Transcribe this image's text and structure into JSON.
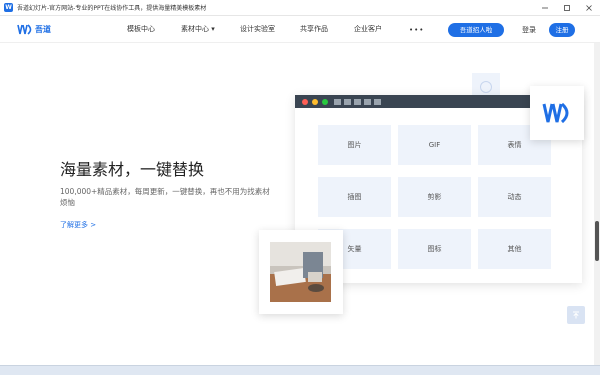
{
  "window": {
    "title": "吾道幻灯片-官方网站-专业的PPT在线协作工具，提供海量精美模板素材",
    "app_icon_text": "W"
  },
  "nav": {
    "logo_text": "吾道",
    "items": [
      {
        "label": "模板中心"
      },
      {
        "label": "素材中心 ▾"
      },
      {
        "label": "设计实验室"
      },
      {
        "label": "共享作品"
      },
      {
        "label": "企业客户"
      }
    ],
    "more": "•••",
    "cta": "吾道招人啦",
    "login": "登录",
    "register": "注册"
  },
  "hero": {
    "title": "海量素材，一键替换",
    "description": "100,000+精品素材，每周更新，一键替换，再也不用为找素材烦恼",
    "link": "了解更多 >"
  },
  "grid": {
    "cells": [
      {
        "label": "图片"
      },
      {
        "label": "GIF"
      },
      {
        "label": "表情"
      },
      {
        "label": "插图"
      },
      {
        "label": "剪影"
      },
      {
        "label": "动态"
      },
      {
        "label": "矢量"
      },
      {
        "label": "图标"
      },
      {
        "label": "其他"
      }
    ]
  },
  "colors": {
    "accent": "#1f6fe5",
    "cell_bg": "#eef3fb",
    "panel_bar": "#3a4552"
  },
  "icons": {
    "logo": "wudao-logo-icon",
    "back_to_top": "arrow-up-icon",
    "more": "ellipsis-icon"
  }
}
